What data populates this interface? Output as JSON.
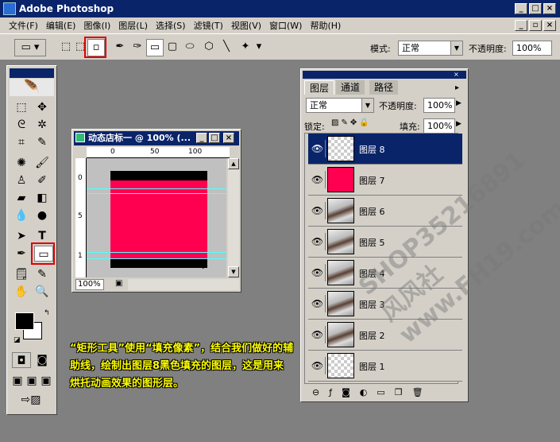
{
  "window": {
    "title": "Adobe Photoshop"
  },
  "menu": [
    "文件(F)",
    "编辑(E)",
    "图像(I)",
    "图层(L)",
    "选择(S)",
    "滤镜(T)",
    "视图(V)",
    "窗口(W)",
    "帮助(H)"
  ],
  "options_bar": {
    "mode_label": "模式:",
    "mode_value": "正常",
    "opacity_label": "不透明度:",
    "opacity_value": "100%"
  },
  "document": {
    "title": "动态店标一 @ 100% (...",
    "zoom": "100%",
    "ruler_top": [
      "0",
      "50",
      "100"
    ],
    "ruler_left": [
      "0",
      "5",
      "1"
    ],
    "canvas_colors": {
      "bar": "#000000",
      "fill": "#ff0050",
      "bg": "#c0c0c0"
    }
  },
  "layers_panel": {
    "tabs": [
      "图层",
      "通道",
      "路径"
    ],
    "blend_mode": "正常",
    "opacity_label": "不透明度:",
    "opacity_value": "100%",
    "lock_label": "锁定:",
    "fill_label": "填充:",
    "fill_value": "100%",
    "layers": [
      {
        "name": "图层 8",
        "thumb": "checker",
        "selected": true
      },
      {
        "name": "图层 7",
        "thumb": "red",
        "selected": false
      },
      {
        "name": "图层 6",
        "thumb": "photo",
        "selected": false
      },
      {
        "name": "图层 5",
        "thumb": "photo",
        "selected": false
      },
      {
        "name": "图层 4",
        "thumb": "photo",
        "selected": false
      },
      {
        "name": "图层 3",
        "thumb": "photo",
        "selected": false
      },
      {
        "name": "图层 2",
        "thumb": "photo",
        "selected": false
      },
      {
        "name": "图层 1",
        "thumb": "checker",
        "selected": false
      }
    ]
  },
  "caption": "“矩形工具”使用“填充像素”，结合我们做好的辅助线，绘制出图层8黑色填充的图层，这是用来烘托动画效果的图形层。",
  "watermark": "SHOP35216891 风风社 www.FH19.com"
}
